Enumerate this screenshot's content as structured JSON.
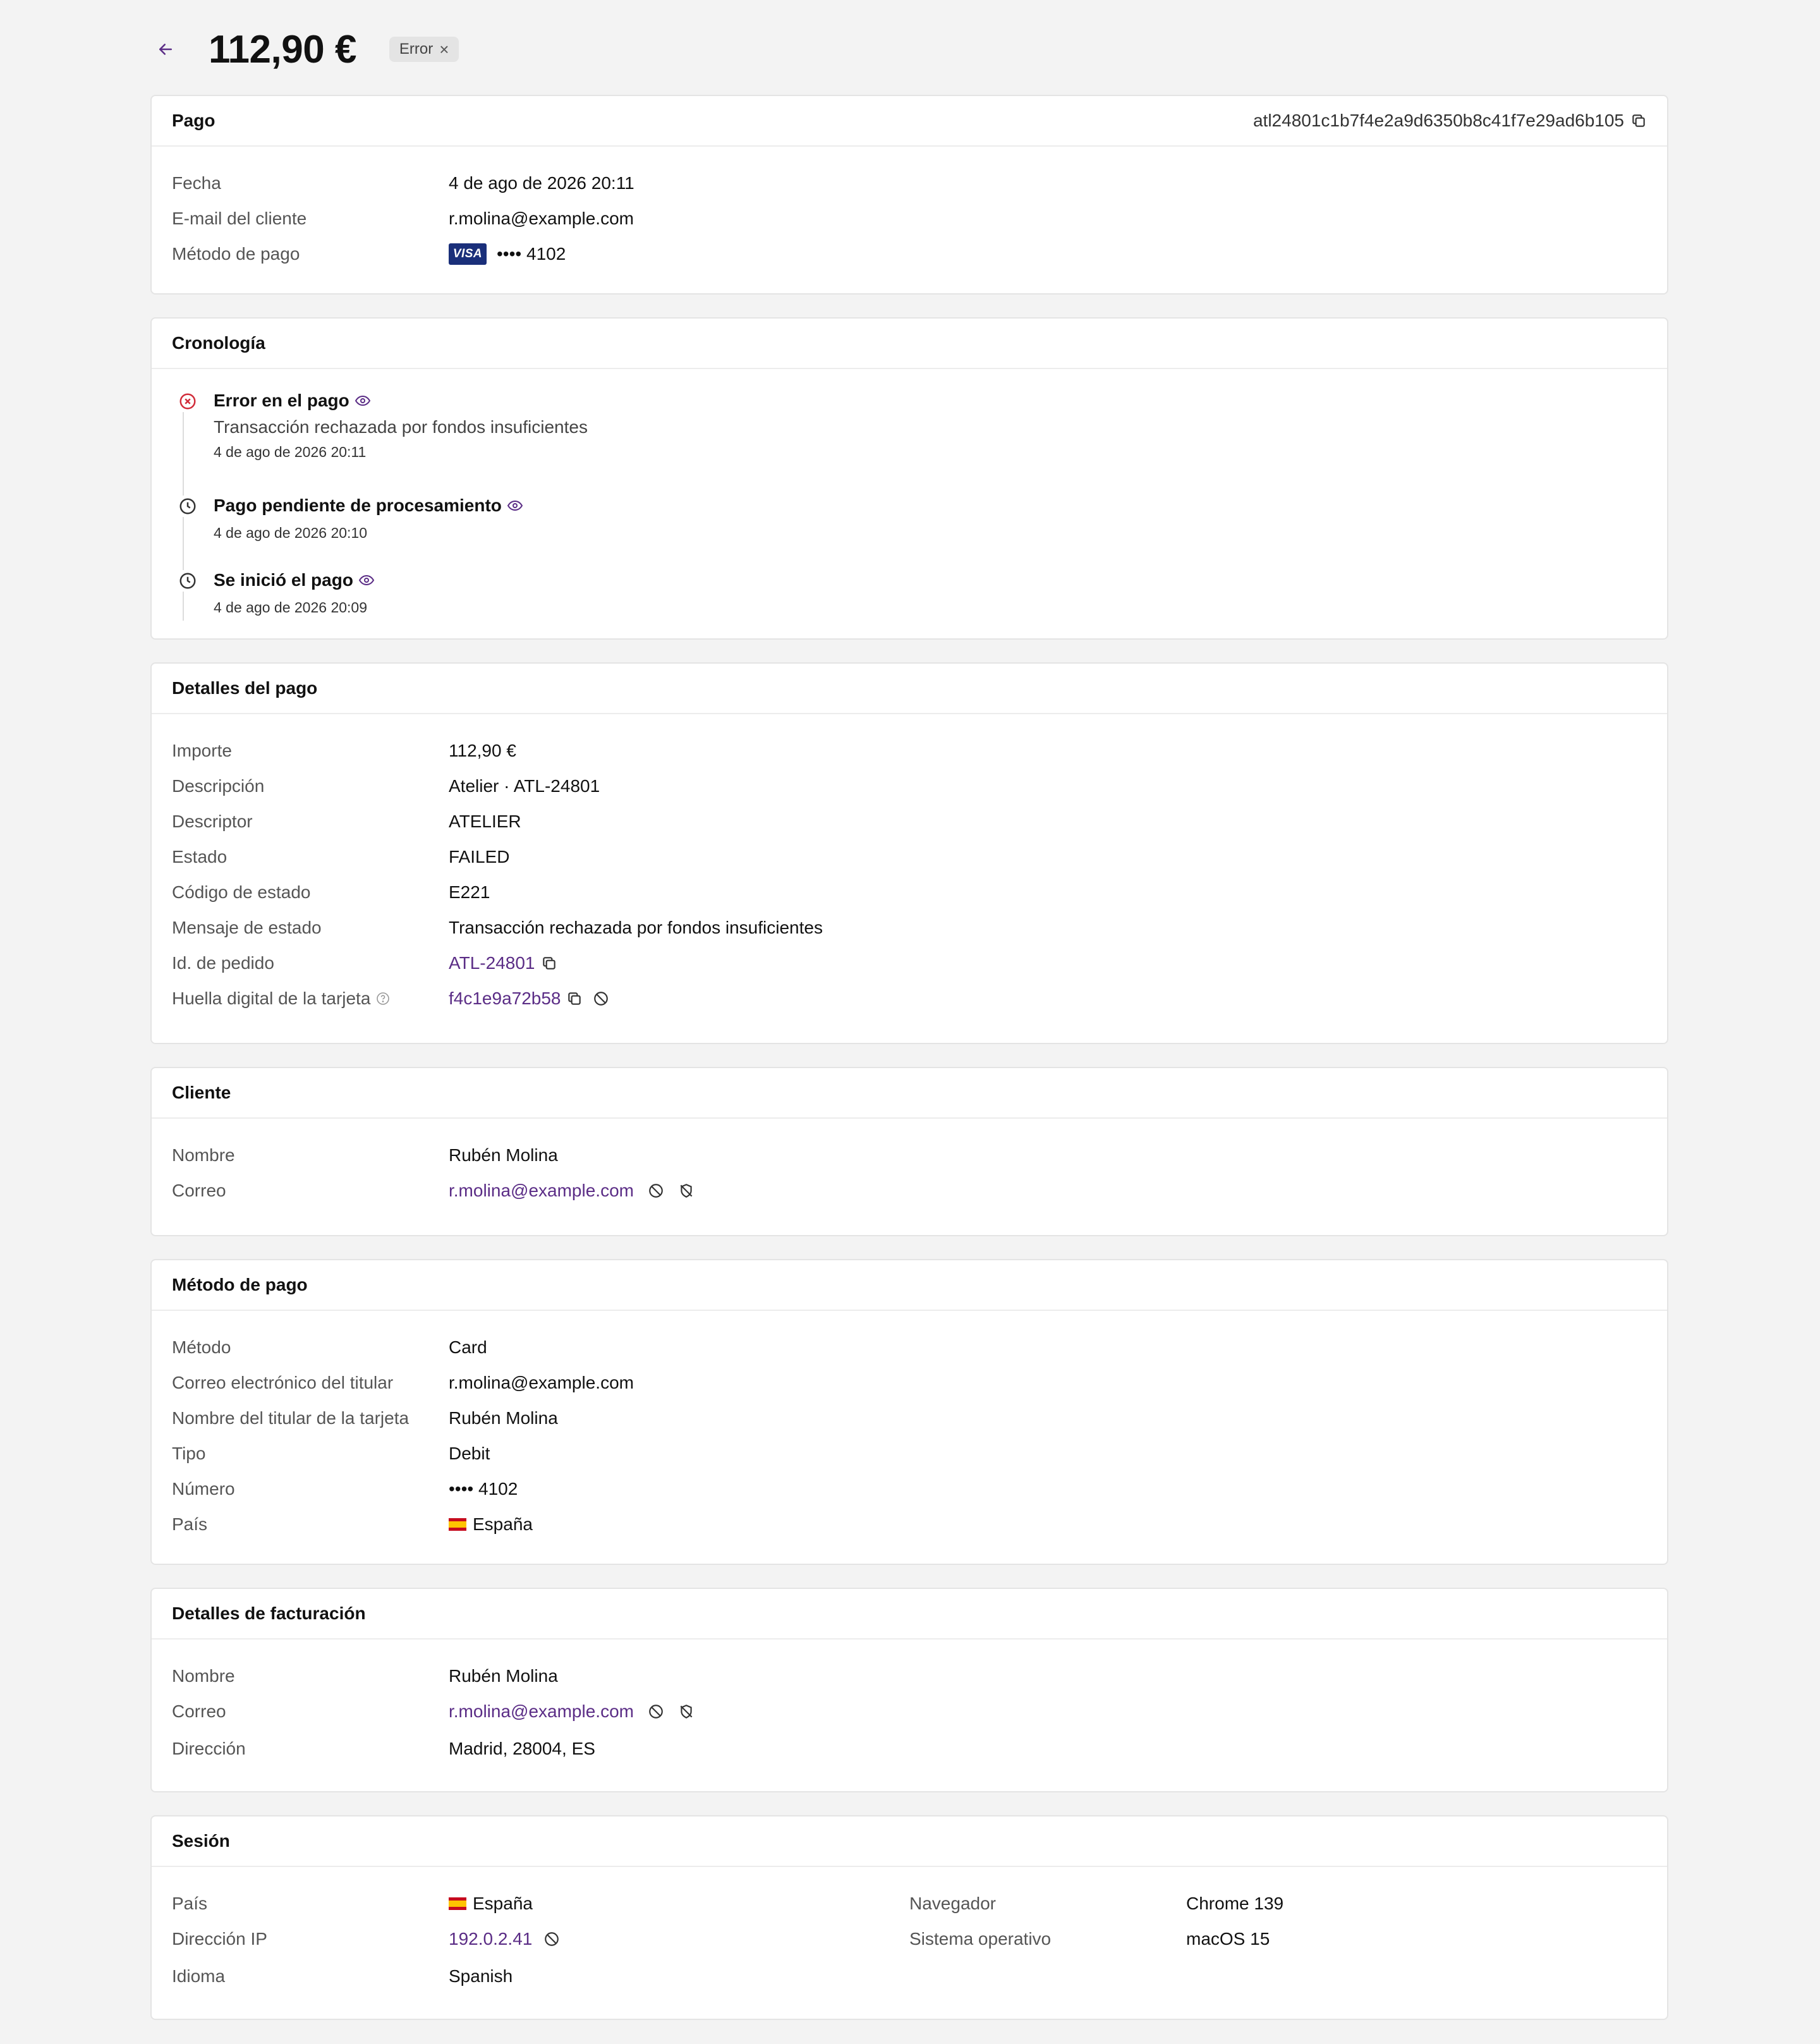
{
  "header": {
    "amount": "112,90 €",
    "status_badge": "Error",
    "status_badge_close": "×"
  },
  "pago": {
    "title": "Pago",
    "payment_id": "atl24801c1b7f4e2a9d6350b8c41f7e29ad6b105",
    "rows": {
      "fecha_label": "Fecha",
      "fecha_value": "4 de ago de 2026 20:11",
      "email_label": "E-mail del cliente",
      "email_value": "r.molina@example.com",
      "metodo_label": "Método de pago",
      "card_brand": "VISA",
      "card_number": "•••• 4102"
    }
  },
  "cronologia": {
    "title": "Cronología",
    "events": [
      {
        "title": "Error en el pago",
        "description": "Transacción rechazada por fondos insuficientes",
        "time": "4 de ago de 2026 20:11"
      },
      {
        "title": "Pago pendiente de procesamiento",
        "time": "4 de ago de 2026 20:10"
      },
      {
        "title": "Se inició el pago",
        "time": "4 de ago de 2026 20:09"
      }
    ]
  },
  "detalles": {
    "title": "Detalles del pago",
    "importe_label": "Importe",
    "importe_value": "112,90 €",
    "descripcion_label": "Descripción",
    "descripcion_value": "Atelier · ATL-24801",
    "descriptor_label": "Descriptor",
    "descriptor_value": "ATELIER",
    "estado_label": "Estado",
    "estado_value": "FAILED",
    "codigo_label": "Código de estado",
    "codigo_value": "E221",
    "mensaje_label": "Mensaje de estado",
    "mensaje_value": "Transacción rechazada por fondos insuficientes",
    "pedido_label": "Id. de pedido",
    "pedido_value": "ATL-24801",
    "huella_label": "Huella digital de la tarjeta",
    "huella_value": "f4c1e9a72b58"
  },
  "cliente": {
    "title": "Cliente",
    "nombre_label": "Nombre",
    "nombre_value": "Rubén Molina",
    "correo_label": "Correo",
    "correo_value": "r.molina@example.com"
  },
  "metodo_pago": {
    "title": "Método de pago",
    "metodo_label": "Método",
    "metodo_value": "Card",
    "correo_label": "Correo electrónico del titular",
    "correo_value": "r.molina@example.com",
    "titular_label": "Nombre del titular de la tarjeta",
    "titular_value": "Rubén Molina",
    "tipo_label": "Tipo",
    "tipo_value": "Debit",
    "numero_label": "Número",
    "numero_value": "•••• 4102",
    "pais_label": "País",
    "pais_value": "España"
  },
  "facturacion": {
    "title": "Detalles de facturación",
    "nombre_label": "Nombre",
    "nombre_value": "Rubén Molina",
    "correo_label": "Correo",
    "correo_value": "r.molina@example.com",
    "direccion_label": "Dirección",
    "direccion_value": "Madrid, 28004, ES"
  },
  "sesion": {
    "title": "Sesión",
    "pais_label": "País",
    "pais_value": "España",
    "ip_label": "Dirección IP",
    "ip_value": "192.0.2.41",
    "idioma_label": "Idioma",
    "idioma_value": "Spanish",
    "navegador_label": "Navegador",
    "navegador_value": "Chrome 139",
    "so_label": "Sistema operativo",
    "so_value": "macOS 15"
  },
  "colors": {
    "accent": "#5b2d86",
    "error": "#d12c3a",
    "background": "#f3f3f3"
  },
  "icons": [
    "arrow-left-icon",
    "copy-icon",
    "eye-icon",
    "error-circle-icon",
    "clock-icon",
    "block-icon",
    "shield-off-icon",
    "help-icon",
    "visa-icon",
    "flag-es-icon"
  ]
}
